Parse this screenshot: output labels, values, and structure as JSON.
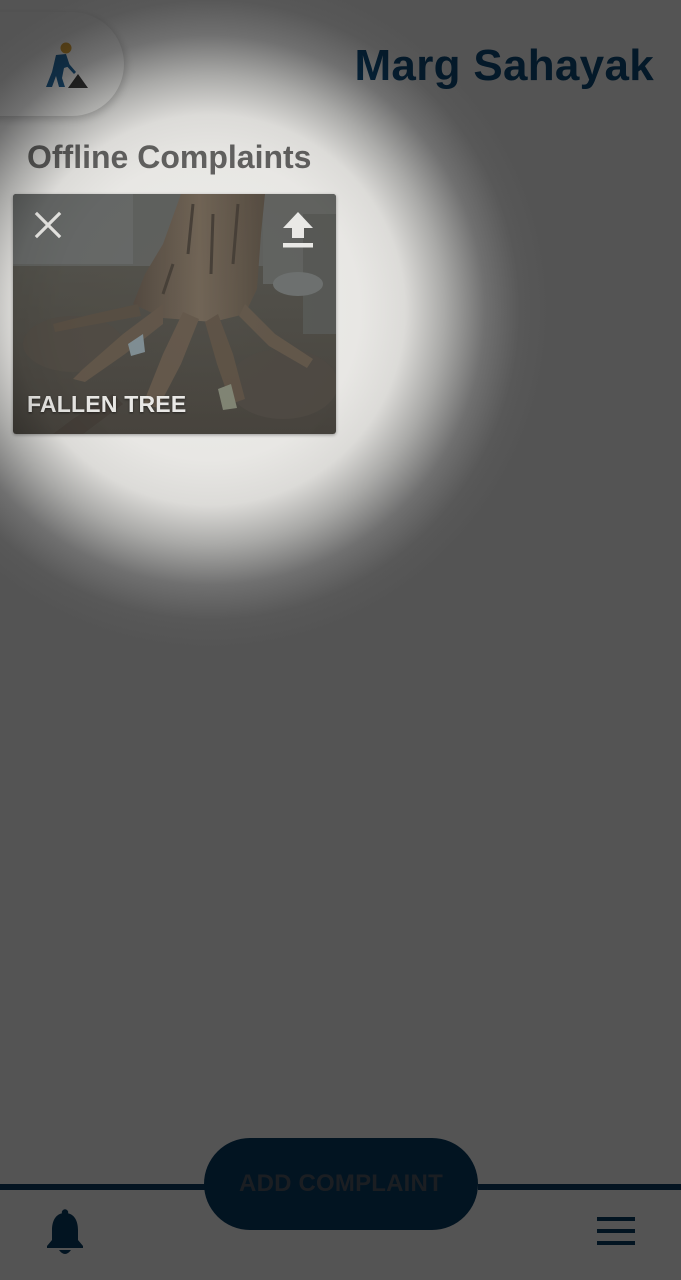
{
  "header": {
    "app_title": "Marg Sahayak",
    "logo_icon": "road-worker-icon"
  },
  "offline": {
    "section_title": "Offline Complaints",
    "complaints": [
      {
        "label": "FALLEN TREE",
        "remove_icon": "close-icon",
        "upload_icon": "upload-icon"
      }
    ]
  },
  "bottom_bar": {
    "add_complaint_label": "ADD COMPLAINT",
    "notifications_icon": "bell-icon",
    "menu_icon": "hamburger-menu-icon"
  },
  "colors": {
    "primary": "#0c4a7a",
    "button_bg": "#063a63",
    "overlay_dim": "#545454",
    "spotlight": "#ececea"
  }
}
